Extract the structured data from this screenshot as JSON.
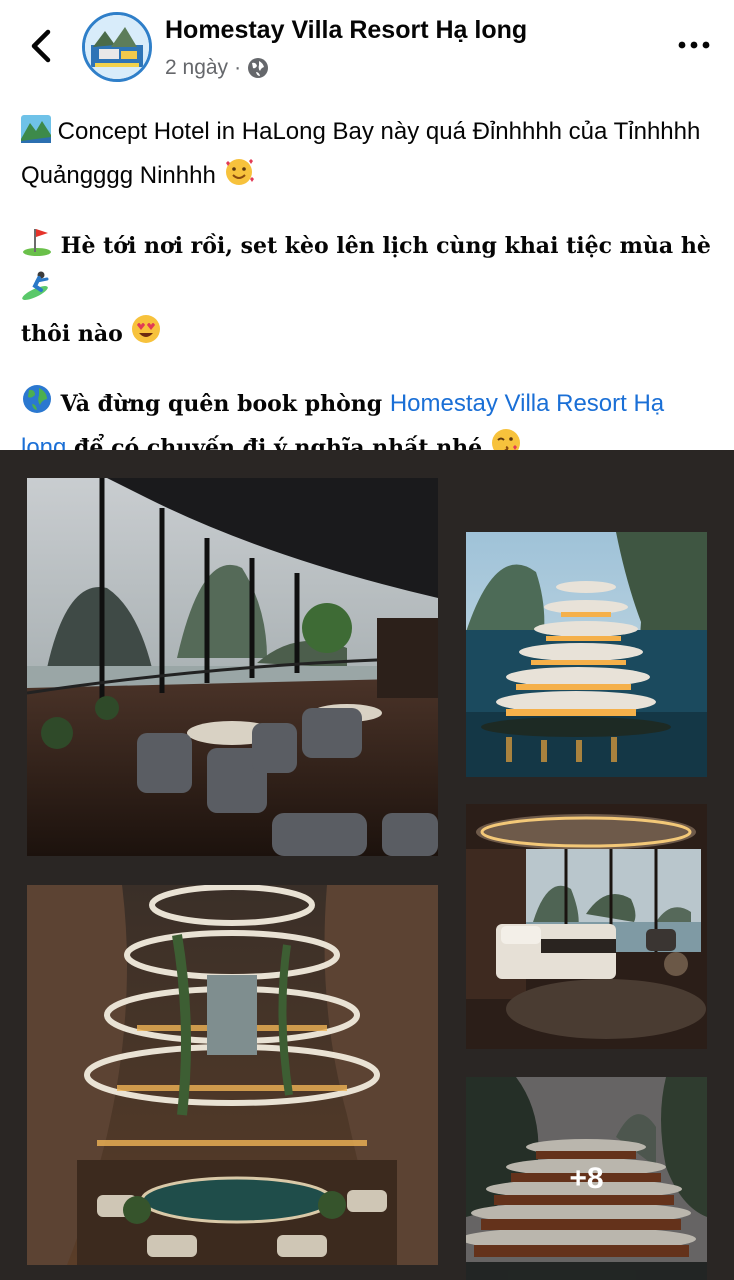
{
  "header": {
    "page_name": "Homestay Villa Resort Hạ long",
    "time": "2 ngày",
    "separator": "·",
    "back_icon": "chevron-left-icon",
    "audience_icon": "globe-icon",
    "more_icon": "more-horizontal-icon"
  },
  "post": {
    "paragraph1": {
      "emoji": "mountain-landscape-emoji",
      "text": "Concept Hotel in HaLong Bay này quá Đỉnhhhh của Tỉnhhhh Quảngggg Ninhhh",
      "trailing_emoji": "smiling-face-with-hearts-emoji"
    },
    "paragraph2": {
      "emoji": "golf-flag-emoji",
      "text": "Hè tới nơi rồi, set kèo lên lịch cùng khai tiệc mùa hè",
      "surfer_emoji": "surfer-emoji",
      "text_cont": "thôi nào",
      "trailing_emoji": "heart-eyes-emoji"
    },
    "paragraph3": {
      "emoji": "globe-emoji",
      "text_before": "Và đừng quên book phòng",
      "link_text": "Homestay Villa Resort Hạ long",
      "text_after": "để có chuyến đi ý nghĩa nhất nhé",
      "trailing_emoji": "kissing-face-emoji"
    }
  },
  "gallery": {
    "images": [
      {
        "name": "restaurant-bay-view-photo"
      },
      {
        "name": "cliff-resort-photo"
      },
      {
        "name": "bedroom-bay-view-photo"
      },
      {
        "name": "cave-atrium-pool-photo"
      },
      {
        "name": "terraced-hotel-photo"
      }
    ],
    "more_count": "+8"
  },
  "colors": {
    "link": "#1a6fd6",
    "gallery_bg": "#2a2624",
    "meta_text": "#65676b"
  }
}
